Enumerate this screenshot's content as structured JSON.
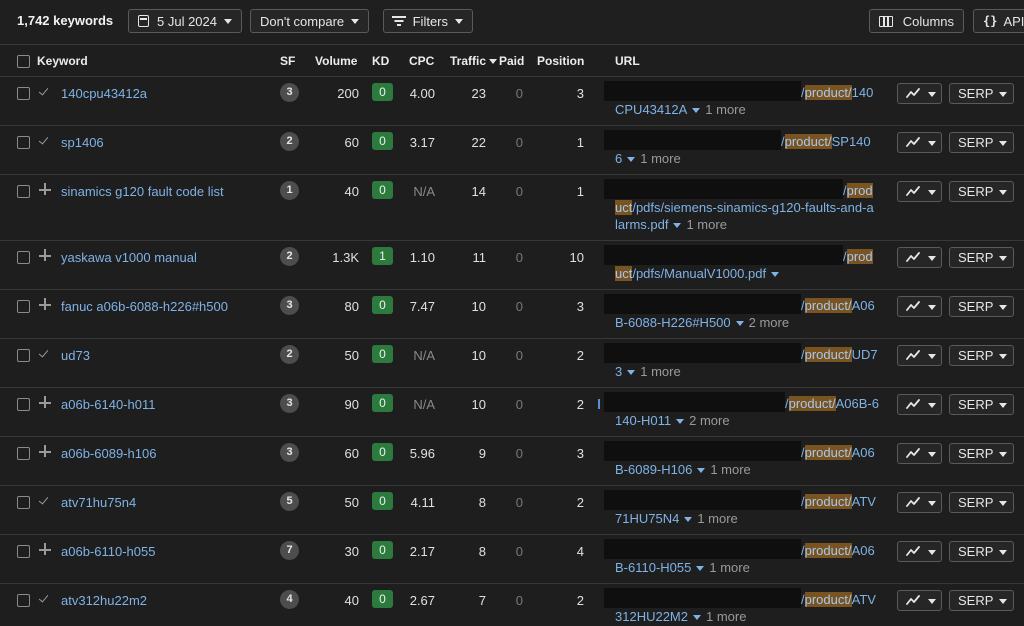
{
  "toolbar": {
    "keyword_count": "1,742 keywords",
    "date_label": "5 Jul 2024",
    "compare_label": "Don't compare",
    "filters_label": "Filters",
    "columns_label": "Columns",
    "api_label": "API"
  },
  "columns": {
    "keyword": "Keyword",
    "sf": "SF",
    "volume": "Volume",
    "kd": "KD",
    "cpc": "CPC",
    "traffic": "Traffic",
    "paid": "Paid",
    "position": "Position",
    "url": "URL"
  },
  "serp_label": "SERP",
  "colors": {
    "link": "#7fb2e6",
    "kd_badge": "#2c7a3e",
    "highlight": "#7a5420"
  },
  "rows": [
    {
      "status": "check",
      "keyword": "140cpu43412a",
      "sf": "3",
      "volume": "200",
      "kd": "0",
      "cpc": "4.00",
      "traffic": "23",
      "paid": "0",
      "position": "3",
      "url1": "/product/140",
      "url_lines": [
        "CPU43412A"
      ],
      "more": "1 more"
    },
    {
      "status": "check",
      "keyword": "sp1406",
      "sf": "2",
      "volume": "60",
      "kd": "0",
      "cpc": "3.17",
      "traffic": "22",
      "paid": "0",
      "position": "1",
      "url1": "/product/SP140",
      "url_lines": [
        "6"
      ],
      "more": "1 more"
    },
    {
      "status": "plus",
      "keyword": "sinamics g120 fault code list",
      "sf": "1",
      "volume": "40",
      "kd": "0",
      "cpc": "N/A",
      "traffic": "14",
      "paid": "0",
      "position": "1",
      "url1": "/prod",
      "url_lines": [
        "uct/pdfs/siemens-sinamics-g120-faults-and-a",
        "larms.pdf"
      ],
      "more": "1 more"
    },
    {
      "status": "plus",
      "keyword": "yaskawa v1000 manual",
      "sf": "2",
      "volume": "1.3K",
      "kd": "1",
      "cpc": "1.10",
      "traffic": "11",
      "paid": "0",
      "position": "10",
      "url1": "/prod",
      "url_lines": [
        "uct/pdfs/ManualV1000.pdf"
      ],
      "more": ""
    },
    {
      "status": "plus",
      "keyword": "fanuc a06b-6088-h226#h500",
      "sf": "3",
      "volume": "80",
      "kd": "0",
      "cpc": "7.47",
      "traffic": "10",
      "paid": "0",
      "position": "3",
      "url1": "/product/A06",
      "url_lines": [
        "B-6088-H226#H500"
      ],
      "more": "2 more"
    },
    {
      "status": "check",
      "keyword": "ud73",
      "sf": "2",
      "volume": "50",
      "kd": "0",
      "cpc": "N/A",
      "traffic": "10",
      "paid": "0",
      "position": "2",
      "url1": "/product/UD7",
      "url_lines": [
        "3"
      ],
      "more": "1 more"
    },
    {
      "status": "plus",
      "keyword": "a06b-6140-h011",
      "sf": "3",
      "volume": "90",
      "kd": "0",
      "cpc": "N/A",
      "traffic": "10",
      "paid": "0",
      "position": "2",
      "url1": "/product/A06B-6",
      "url_lines": [
        "140-H011"
      ],
      "more": "2 more"
    },
    {
      "status": "plus",
      "keyword": "a06b-6089-h106",
      "sf": "3",
      "volume": "60",
      "kd": "0",
      "cpc": "5.96",
      "traffic": "9",
      "paid": "0",
      "position": "3",
      "url1": "/product/A06",
      "url_lines": [
        "B-6089-H106"
      ],
      "more": "1 more"
    },
    {
      "status": "check",
      "keyword": "atv71hu75n4",
      "sf": "5",
      "volume": "50",
      "kd": "0",
      "cpc": "4.11",
      "traffic": "8",
      "paid": "0",
      "position": "2",
      "url1": "/product/ATV",
      "url_lines": [
        "71HU75N4"
      ],
      "more": "1 more"
    },
    {
      "status": "plus",
      "keyword": "a06b-6110-h055",
      "sf": "7",
      "volume": "30",
      "kd": "0",
      "cpc": "2.17",
      "traffic": "8",
      "paid": "0",
      "position": "4",
      "url1": "/product/A06",
      "url_lines": [
        "B-6110-H055"
      ],
      "more": "1 more"
    },
    {
      "status": "check",
      "keyword": "atv312hu22m2",
      "sf": "4",
      "volume": "40",
      "kd": "0",
      "cpc": "2.67",
      "traffic": "7",
      "paid": "0",
      "position": "2",
      "url1": "/product/ATV",
      "url_lines": [
        "312HU22M2"
      ],
      "more": "1 more"
    }
  ]
}
